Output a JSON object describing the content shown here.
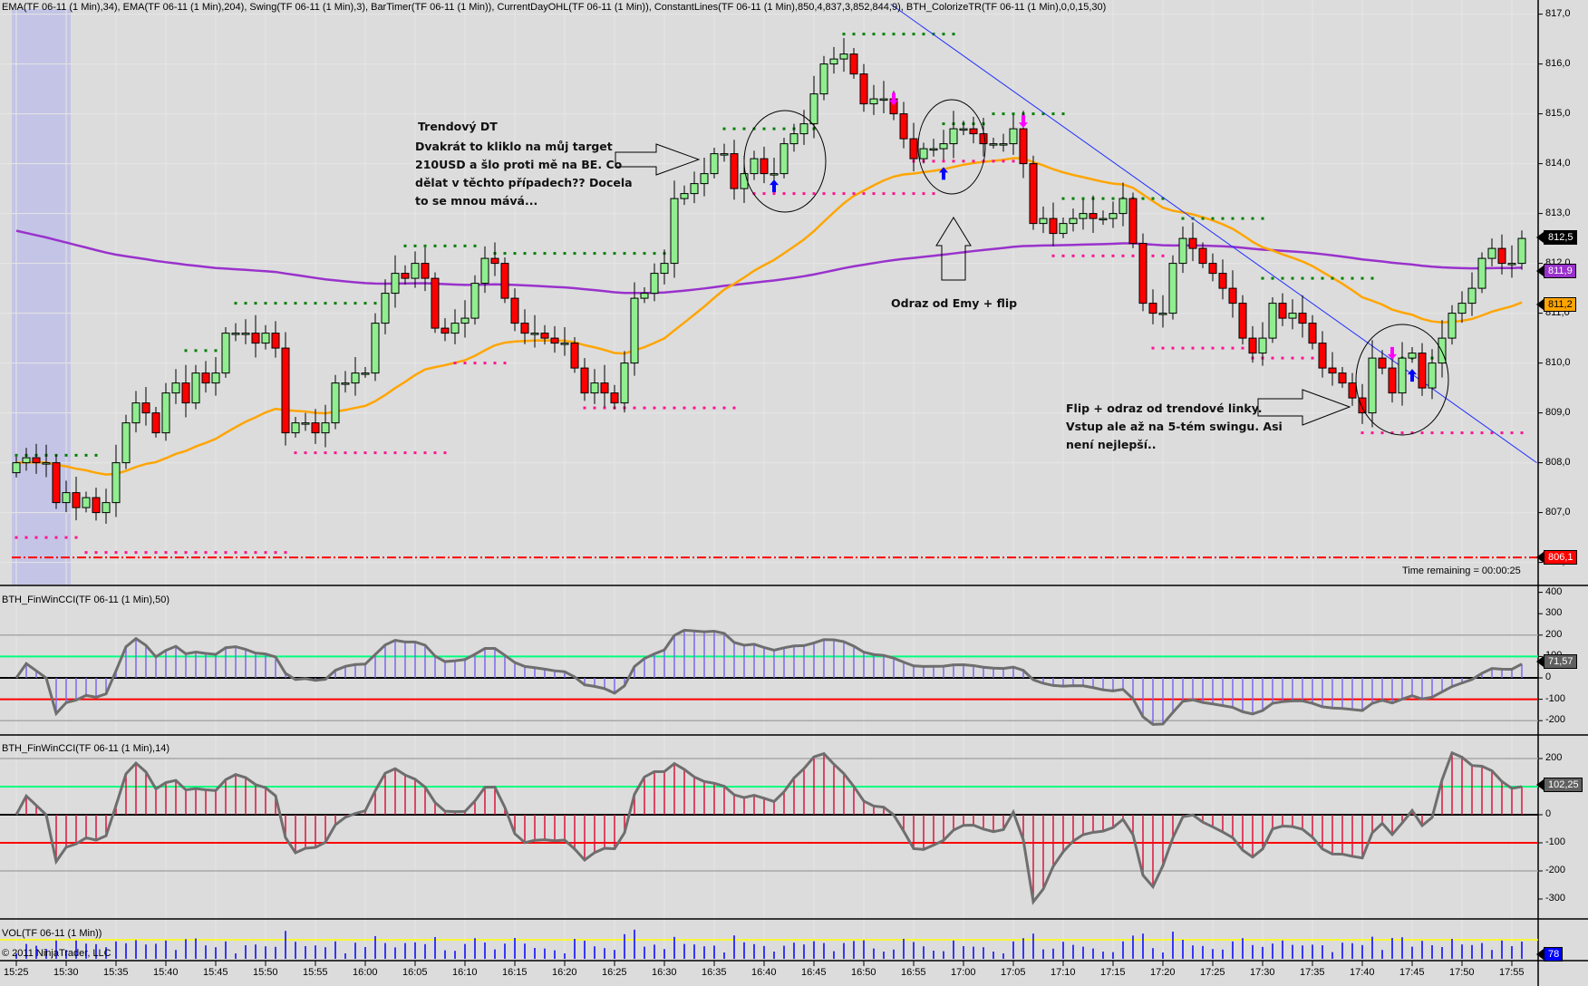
{
  "header": {
    "indicators": "EMA(TF 06-11 (1 Min),34), EMA(TF 06-11 (1 Min),204), Swing(TF 06-11 (1 Min),3), BarTimer(TF 06-11 (1 Min)), CurrentDayOHL(TF 06-11 (1 Min)), ConstantLines(TF 06-11 (1 Min),850,4,837,3,852,844,9), BTH_ColorizeTR(TF 06-11 (1 Min),0,0,15,30)"
  },
  "price_panel": {
    "axis_labels": [
      "817,0",
      "816,0",
      "815,0",
      "814,0",
      "813,0",
      "812,0",
      "811,0",
      "810,0",
      "809,0",
      "808,0",
      "807,0",
      "806,0"
    ],
    "tags": {
      "last": "812,5",
      "ema204": "811,9",
      "ema34": "811,2",
      "low": "806,1"
    },
    "time_remaining": "Time remaining = 00:00:25",
    "low_line": 806.1,
    "ema204_seed": 812.7,
    "colors": {
      "up": "#90ee90",
      "down": "#ff0000",
      "ema34": "#ffa500",
      "ema204": "#9932cc",
      "swing_high": "#008000",
      "swing_low": "#ff1493",
      "trendline": "#2030ff"
    },
    "closes": [
      808.0,
      808.1,
      808.0,
      808.0,
      807.2,
      807.4,
      807.1,
      807.3,
      807.0,
      807.2,
      808.0,
      808.8,
      809.2,
      809.0,
      808.6,
      809.4,
      809.6,
      809.2,
      809.8,
      809.6,
      809.8,
      810.6,
      810.6,
      810.6,
      810.4,
      810.6,
      810.3,
      808.6,
      808.8,
      808.8,
      808.6,
      808.8,
      809.6,
      809.6,
      809.8,
      809.8,
      810.8,
      811.4,
      811.8,
      811.7,
      812.0,
      811.7,
      810.7,
      810.6,
      810.8,
      810.9,
      811.6,
      812.1,
      812.0,
      811.3,
      810.8,
      810.6,
      810.6,
      810.5,
      810.4,
      810.4,
      809.9,
      809.4,
      809.6,
      809.4,
      809.2,
      810.0,
      811.3,
      811.4,
      811.8,
      812.0,
      813.3,
      813.4,
      813.6,
      813.8,
      814.2,
      814.2,
      813.5,
      813.8,
      814.1,
      813.8,
      813.8,
      814.4,
      814.6,
      814.8,
      815.4,
      816.0,
      816.1,
      816.2,
      815.8,
      815.2,
      815.3,
      815.3,
      815.0,
      814.5,
      814.1,
      814.3,
      814.3,
      814.4,
      814.7,
      814.7,
      814.6,
      814.4,
      814.4,
      814.4,
      814.7,
      814.0,
      812.8,
      812.9,
      812.6,
      812.8,
      812.9,
      813.0,
      812.9,
      812.9,
      813.0,
      813.3,
      812.4,
      811.2,
      811.0,
      811.0,
      812.0,
      812.5,
      812.3,
      812.0,
      811.8,
      811.5,
      811.2,
      810.5,
      810.2,
      810.5,
      811.2,
      810.9,
      811.0,
      810.8,
      810.4,
      809.9,
      809.8,
      809.6,
      809.3,
      809.0,
      810.1,
      809.9,
      809.4,
      810.1,
      810.2,
      809.5,
      810.0,
      810.5,
      811.0,
      811.2,
      811.5,
      812.1,
      812.3,
      812.0,
      812.0,
      812.5
    ],
    "swing_highs": [
      [
        808.15,
        0,
        8
      ],
      [
        810.25,
        17,
        21
      ],
      [
        811.2,
        22,
        36
      ],
      [
        812.35,
        39,
        46
      ],
      [
        812.2,
        48,
        66
      ],
      [
        814.7,
        71,
        80
      ],
      [
        816.6,
        83,
        94
      ],
      [
        814.8,
        93,
        97
      ],
      [
        815.0,
        98,
        105
      ],
      [
        813.3,
        105,
        115
      ],
      [
        812.9,
        117,
        125
      ],
      [
        811.7,
        125,
        136
      ],
      [
        810.1,
        138,
        143
      ]
    ],
    "swing_lows": [
      [
        806.5,
        0,
        6
      ],
      [
        806.2,
        7,
        27
      ],
      [
        808.2,
        28,
        43
      ],
      [
        810.0,
        44,
        49
      ],
      [
        809.1,
        57,
        72
      ],
      [
        813.4,
        74,
        92
      ],
      [
        814.05,
        90,
        100
      ],
      [
        812.15,
        104,
        115
      ],
      [
        810.3,
        114,
        125
      ],
      [
        810.1,
        124,
        131
      ],
      [
        808.6,
        135,
        151
      ]
    ],
    "trendline": [
      [
        87.7,
        817.2
      ],
      [
        152.5,
        808.0
      ]
    ],
    "signals_up": [
      [
        76,
        813.5
      ],
      [
        93,
        813.75
      ],
      [
        140,
        809.7
      ]
    ],
    "signals_down": [
      [
        88,
        815.35
      ],
      [
        101,
        814.9
      ],
      [
        138,
        810.25
      ]
    ]
  },
  "annotations": {
    "trend_title": "Trendový DT",
    "trend_lines": [
      "Dvakrát to kliklo na můj target",
      "210USD a šlo proti mě na BE. Co",
      "dělat v těchto případech?? Docela",
      "to se mnou mává..."
    ],
    "ema_bounce": "Odraz od Emy + flip",
    "flip_lines": [
      "Flip + odraz od trendové linky.",
      "Vstup ale až na 5-tém swingu. Asi",
      "není nejlepší.."
    ]
  },
  "cci50": {
    "title": "BTH_FinWinCCI(TF 06-11 (1 Min),50)",
    "axis_labels": [
      "400",
      "300",
      "200",
      "100",
      "0",
      "-100",
      "-200"
    ],
    "value": "71,57",
    "period": 50,
    "color": "#7b68ee"
  },
  "cci14": {
    "title": "BTH_FinWinCCI(TF 06-11 (1 Min),14)",
    "axis_labels": [
      "200",
      "100",
      "0",
      "-100",
      "-200",
      "-300"
    ],
    "value": "102,25",
    "period": 14,
    "color": "#dc143c"
  },
  "volume": {
    "title": "VOL(TF 06-11 (1 Min))",
    "copyright": "© 2011 NinjaTrader, LLC",
    "value": "78",
    "color": "#0000ff"
  },
  "time_axis": [
    "15:25",
    "15:30",
    "15:35",
    "15:40",
    "15:45",
    "15:50",
    "15:55",
    "16:00",
    "16:05",
    "16:10",
    "16:15",
    "16:20",
    "16:25",
    "16:30",
    "16:35",
    "16:40",
    "16:45",
    "16:50",
    "16:55",
    "17:00",
    "17:05",
    "17:10",
    "17:15",
    "17:20",
    "17:25",
    "17:30",
    "17:35",
    "17:40",
    "17:45",
    "17:50",
    "17:55"
  ]
}
